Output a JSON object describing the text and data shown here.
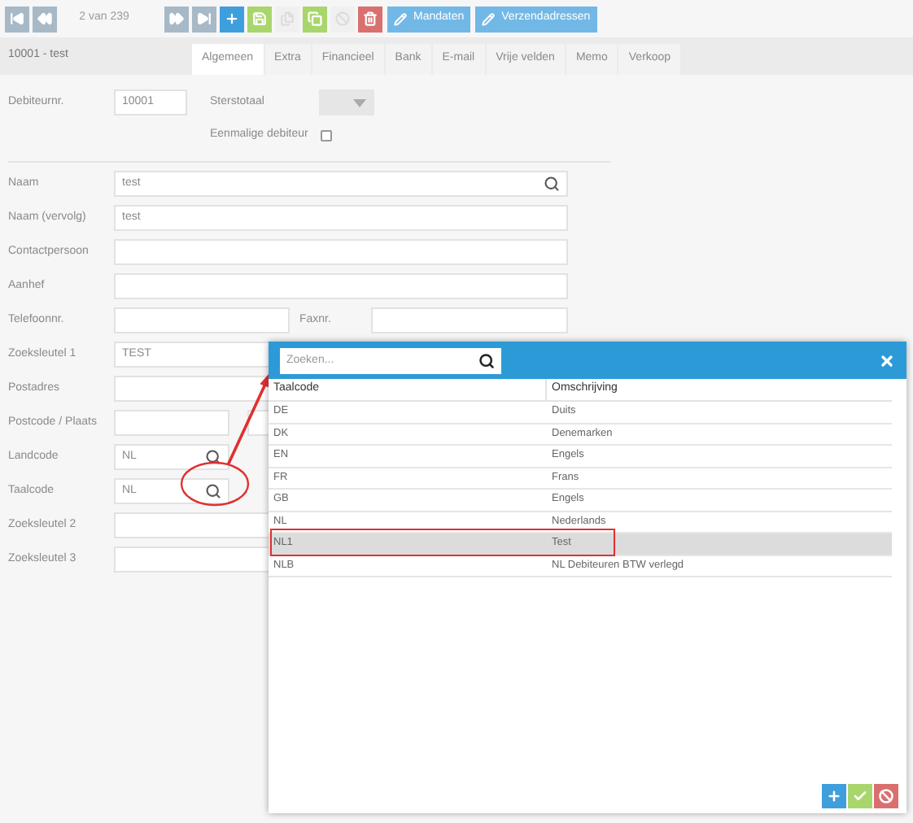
{
  "toolbar": {
    "items": [
      {
        "kind": "icon",
        "disabled": false
      },
      {
        "kind": "icon",
        "disabled": false
      },
      {
        "kind": "text",
        "label": "2 van 239"
      },
      {
        "kind": "icon",
        "disabled": false
      },
      {
        "kind": "icon",
        "disabled": false
      },
      {
        "kind": "icon",
        "disabled": false
      },
      {
        "kind": "icon",
        "disabled": false
      },
      {
        "kind": "icon",
        "disabled": true
      },
      {
        "kind": "icon",
        "disabled": false
      },
      {
        "kind": "icon",
        "disabled": true
      },
      {
        "kind": "icon",
        "disabled": false
      },
      {
        "kind": "labeled",
        "label": "Mandaten",
        "disabled": false
      },
      {
        "kind": "labeled",
        "label": "Verzendadressen",
        "disabled": false
      }
    ]
  },
  "record": {
    "title": "10001 - test"
  },
  "tabs": [
    {
      "label": "Algemeen",
      "selected": true
    },
    {
      "label": "Extra",
      "selected": false
    },
    {
      "label": "Financieel",
      "selected": false
    },
    {
      "label": "Bank",
      "selected": false
    },
    {
      "label": "E-mail",
      "selected": false
    },
    {
      "label": "Vrije velden",
      "selected": false
    },
    {
      "label": "Memo",
      "selected": false
    },
    {
      "label": "Verkoop",
      "selected": false
    }
  ],
  "form": {
    "debiteurnr": {
      "label": "Debiteurnr.",
      "value": "10001"
    },
    "sterstotaal": {
      "label": "Sterstotaal"
    },
    "eenmalig": {
      "label": "Eenmalige debiteur",
      "checked": false
    },
    "fields": [
      {
        "kind": "search",
        "label": "Naam",
        "value": "test"
      },
      {
        "kind": "text",
        "label": "Naam (vervolg)",
        "value": "test"
      },
      {
        "kind": "text",
        "label": "Contactpersoon"
      },
      {
        "kind": "text",
        "label": "Aanhef"
      },
      {
        "kind": "pair",
        "label": "Telefoonnr.",
        "second_label": "Faxnr."
      },
      {
        "kind": "pair",
        "label": "Zoeksleutel 1",
        "value": "TEST"
      },
      {
        "kind": "text",
        "label": "Postadres"
      },
      {
        "kind": "split",
        "label": "Postcode / Plaats"
      },
      {
        "kind": "short-search",
        "label": "Landcode",
        "value": "NL"
      },
      {
        "kind": "short-search",
        "label": "Taalcode",
        "value": "NL",
        "circled": true
      },
      {
        "kind": "text",
        "label": "Zoeksleutel 2"
      },
      {
        "kind": "text",
        "label": "Zoeksleutel 3"
      }
    ]
  },
  "lookup": {
    "search": {
      "placeholder": "Zoeken..."
    },
    "columns": [
      "Taalcode",
      "Omschrijving"
    ],
    "rows": [
      {
        "cells": [
          "DE",
          "Duits"
        ],
        "selected": false,
        "annotated": false
      },
      {
        "cells": [
          "DK",
          "Denemarken"
        ],
        "selected": false,
        "annotated": false
      },
      {
        "cells": [
          "EN",
          "Engels"
        ],
        "selected": false,
        "annotated": false
      },
      {
        "cells": [
          "FR",
          "Frans"
        ],
        "selected": false,
        "annotated": false
      },
      {
        "cells": [
          "GB",
          "Engels"
        ],
        "selected": false,
        "annotated": false
      },
      {
        "cells": [
          "NL",
          "Nederlands"
        ],
        "selected": false,
        "annotated": false
      },
      {
        "cells": [
          "NL1",
          "Test"
        ],
        "selected": true,
        "annotated": true
      },
      {
        "cells": [
          "NLB",
          "NL Debiteuren BTW verlegd"
        ],
        "selected": false,
        "annotated": false
      }
    ]
  }
}
